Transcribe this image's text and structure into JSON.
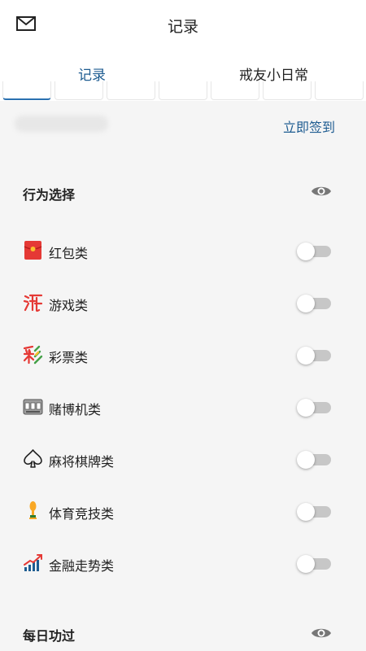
{
  "header": {
    "title": "记录",
    "mail_icon": "mail-icon"
  },
  "tabs": [
    {
      "label": "记录",
      "active": true
    },
    {
      "label": "戒友小日常",
      "active": false
    }
  ],
  "checkin": {
    "link_label": "立即签到"
  },
  "behavior_section": {
    "title": "行为选择",
    "visibility_icon": "eye-icon",
    "items": [
      {
        "label": "红包类",
        "icon": "red-envelope-icon",
        "enabled": false
      },
      {
        "label": "游戏类",
        "icon": "game-glyph-icon",
        "enabled": false
      },
      {
        "label": "彩票类",
        "icon": "lottery-glyph-icon",
        "enabled": false
      },
      {
        "label": "赌博机类",
        "icon": "slot-machine-icon",
        "enabled": false
      },
      {
        "label": "麻将棋牌类",
        "icon": "spade-icon",
        "enabled": false
      },
      {
        "label": "体育竞技类",
        "icon": "trophy-icon",
        "enabled": false
      },
      {
        "label": "金融走势类",
        "icon": "trend-chart-icon",
        "enabled": false
      }
    ]
  },
  "daily_section": {
    "title": "每日功过",
    "visibility_icon": "eye-icon"
  },
  "colors": {
    "accent": "#1e5c91",
    "toggle_off": "#c7c7c7",
    "background": "#f5f5f5"
  }
}
